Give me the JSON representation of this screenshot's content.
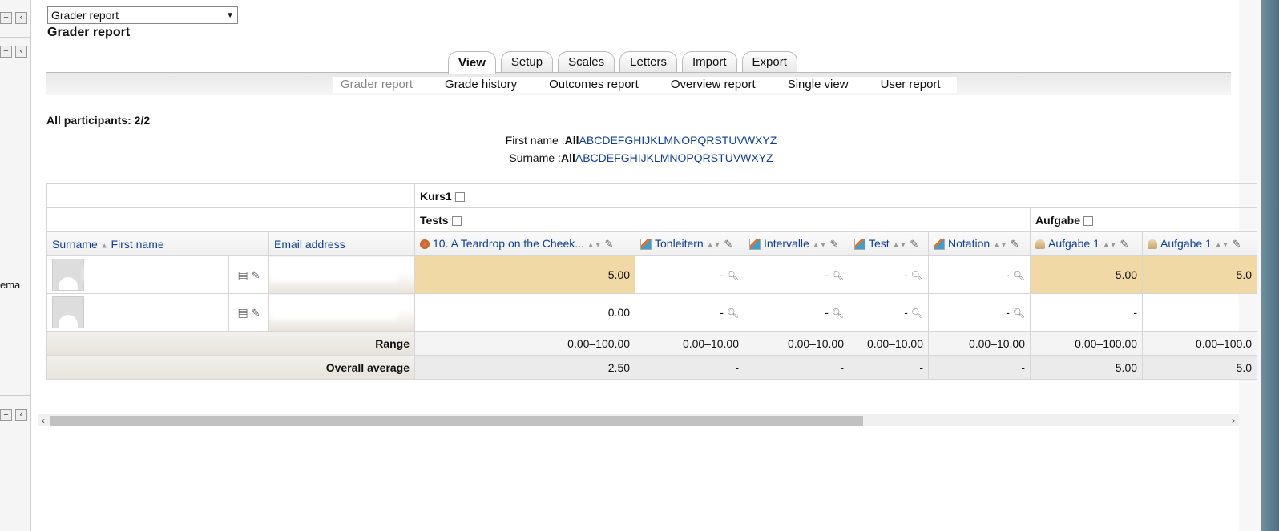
{
  "left_panel": {
    "fragment_text": "ema"
  },
  "report_select": {
    "value": "Grader report"
  },
  "page_title": "Grader report",
  "tabs": [
    {
      "label": "View",
      "active": true
    },
    {
      "label": "Setup"
    },
    {
      "label": "Scales"
    },
    {
      "label": "Letters"
    },
    {
      "label": "Import"
    },
    {
      "label": "Export"
    }
  ],
  "subtabs": [
    {
      "label": "Grader report",
      "current": true
    },
    {
      "label": "Grade history"
    },
    {
      "label": "Outcomes report"
    },
    {
      "label": "Overview report"
    },
    {
      "label": "Single view"
    },
    {
      "label": "User report"
    }
  ],
  "participants": "All participants: 2/2",
  "initials_filter": {
    "firstname_label": "First name :",
    "surname_label": "Surname :",
    "all": "All",
    "letters": [
      "A",
      "B",
      "C",
      "D",
      "E",
      "F",
      "G",
      "H",
      "I",
      "J",
      "K",
      "L",
      "M",
      "N",
      "O",
      "P",
      "Q",
      "R",
      "S",
      "T",
      "U",
      "V",
      "W",
      "X",
      "Y",
      "Z"
    ]
  },
  "grades_table": {
    "category_course": "Kurs1",
    "category_tests": "Tests",
    "category_aufgabe": "Aufgabe",
    "col_surname": "Surname",
    "col_firstname": "First name",
    "col_email": "Email address",
    "items": [
      {
        "name": "10. A Teardrop on the Cheek...",
        "icon": "lesson-icon"
      },
      {
        "name": "Tonleitern",
        "icon": "quiz-icon"
      },
      {
        "name": "Intervalle",
        "icon": "quiz-icon"
      },
      {
        "name": "Test",
        "icon": "quiz-icon"
      },
      {
        "name": "Notation",
        "icon": "quiz-icon"
      },
      {
        "name": "Aufgabe 1",
        "icon": "assign-icon"
      },
      {
        "name": "Aufgabe 1",
        "icon": "assign-icon"
      }
    ],
    "rows": [
      {
        "grades": [
          "5.00",
          "-",
          "-",
          "-",
          "-",
          "5.00",
          "5.0"
        ]
      },
      {
        "grades": [
          "0.00",
          "-",
          "-",
          "-",
          "-",
          "-",
          ""
        ]
      }
    ],
    "range_label": "Range",
    "range": [
      "0.00–100.00",
      "0.00–10.00",
      "0.00–10.00",
      "0.00–10.00",
      "0.00–10.00",
      "0.00–100.00",
      "0.00–100.0"
    ],
    "average_label": "Overall average",
    "average": [
      "2.50",
      "-",
      "-",
      "-",
      "-",
      "5.00",
      "5.0"
    ]
  },
  "colors": {
    "link": "#0f3f9e",
    "highlight": "#f1d9a5"
  }
}
